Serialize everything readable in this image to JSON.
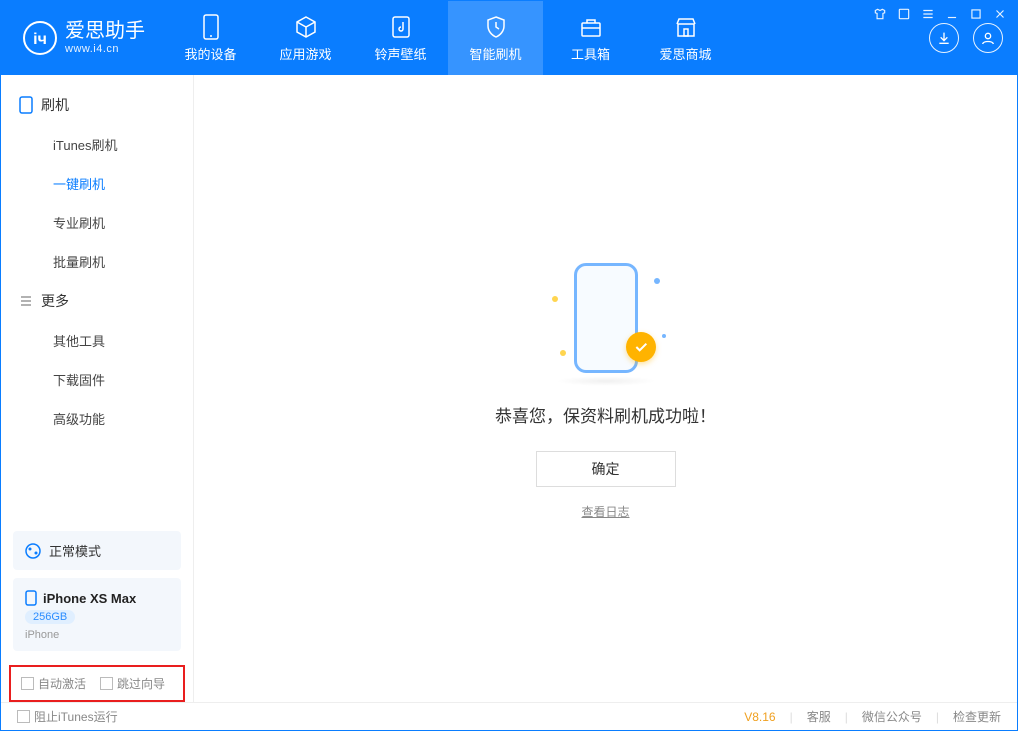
{
  "app": {
    "name": "爱思助手",
    "site": "www.i4.cn"
  },
  "tabs": {
    "device": "我的设备",
    "apps": "应用游戏",
    "ring": "铃声壁纸",
    "flash": "智能刷机",
    "tools": "工具箱",
    "store": "爱思商城"
  },
  "sidebar": {
    "group_flash": "刷机",
    "itunes_flash": "iTunes刷机",
    "one_click": "一键刷机",
    "pro_flash": "专业刷机",
    "batch_flash": "批量刷机",
    "group_more": "更多",
    "other_tools": "其他工具",
    "download_fw": "下载固件",
    "advanced": "高级功能"
  },
  "mode": {
    "label": "正常模式"
  },
  "device": {
    "name": "iPhone XS Max",
    "capacity": "256GB",
    "type": "iPhone"
  },
  "checks": {
    "auto_activate": "自动激活",
    "skip_guide": "跳过向导"
  },
  "main": {
    "success": "恭喜您，保资料刷机成功啦！",
    "ok": "确定",
    "view_log": "查看日志"
  },
  "footer": {
    "block_itunes": "阻止iTunes运行",
    "version": "V8.16",
    "service": "客服",
    "wechat": "微信公众号",
    "check_update": "检查更新"
  }
}
